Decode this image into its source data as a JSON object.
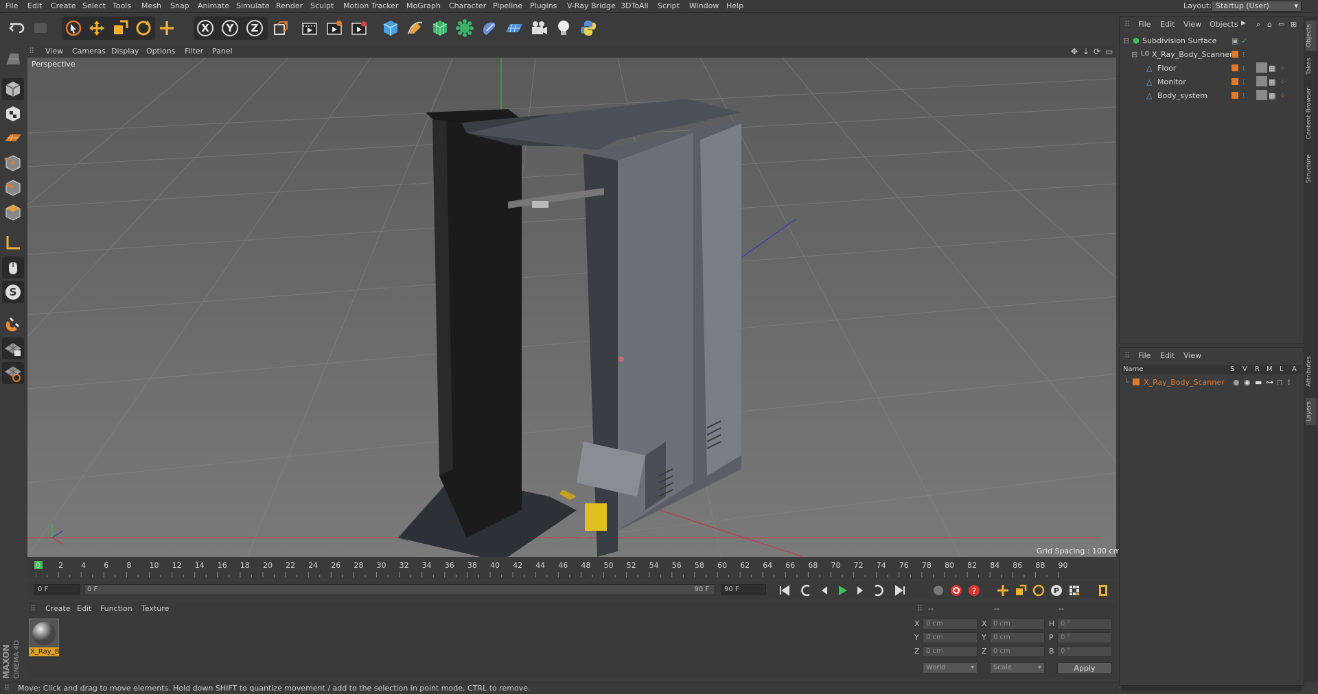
{
  "menubar": {
    "items": [
      "File",
      "Edit",
      "Create",
      "Select",
      "Tools",
      "Mesh",
      "Snap",
      "Animate",
      "Simulate",
      "Render",
      "Sculpt",
      "Motion Tracker",
      "MoGraph",
      "Character",
      "Pipeline",
      "Plugins",
      "V-Ray Bridge",
      "3DToAll",
      "Script",
      "Window",
      "Help"
    ],
    "layout_label": "Layout:",
    "layout_value": "Startup (User)"
  },
  "toolbar": {
    "icons": [
      "undo-icon",
      "redo-icon",
      "live-selection-icon",
      "move-icon",
      "scale-icon",
      "rotate-icon",
      "last-tool-icon",
      "x-axis-icon",
      "y-axis-icon",
      "z-axis-icon",
      "world-coordinates-icon",
      "render-view-icon",
      "render-picture-viewer-icon",
      "edit-render-settings-icon",
      "cube-icon",
      "pen-icon",
      "subdivision-icon",
      "array-icon",
      "deformer-icon",
      "floor-icon",
      "camera-icon",
      "light-icon",
      "python-icon"
    ],
    "axis_labels": [
      "X",
      "Y",
      "Z"
    ]
  },
  "viewport": {
    "menu": [
      "View",
      "Cameras",
      "Display",
      "Options",
      "Filter",
      "Panel"
    ],
    "label": "Perspective",
    "grid_spacing": "Grid Spacing : 100 cm"
  },
  "timeline": {
    "ticks": [
      "0",
      "2",
      "4",
      "6",
      "8",
      "10",
      "12",
      "14",
      "16",
      "18",
      "20",
      "22",
      "24",
      "26",
      "28",
      "30",
      "32",
      "34",
      "36",
      "38",
      "40",
      "42",
      "44",
      "46",
      "48",
      "50",
      "52",
      "54",
      "56",
      "58",
      "60",
      "62",
      "64",
      "66",
      "68",
      "70",
      "72",
      "74",
      "76",
      "78",
      "80",
      "82",
      "84",
      "86",
      "88",
      "90"
    ],
    "current_frame": "0 F",
    "end_frame": "0 F"
  },
  "playbar": {
    "start": "0 F",
    "range_start": "0 F",
    "range_end": "90 F",
    "end": "90 F"
  },
  "material_manager": {
    "menu": [
      "Create",
      "Edit",
      "Function",
      "Texture"
    ],
    "material_name": "X_Ray_B"
  },
  "coordinates": {
    "headers": [
      "--",
      "--",
      "--"
    ],
    "rows": [
      {
        "a": "X",
        "av": "0 cm",
        "b": "X",
        "bv": "0 cm",
        "c": "H",
        "cv": "0 °"
      },
      {
        "a": "Y",
        "av": "0 cm",
        "b": "Y",
        "bv": "0 cm",
        "c": "P",
        "cv": "0 °"
      },
      {
        "a": "Z",
        "av": "0 cm",
        "b": "Z",
        "bv": "0 cm",
        "c": "B",
        "cv": "0 °"
      }
    ],
    "mode": "World",
    "mode2": "Scale",
    "apply": "Apply"
  },
  "status": "Move: Click and drag to move elements. Hold down SHIFT to quantize movement / add to the selection in point mode, CTRL to remove.",
  "object_manager": {
    "menu": [
      "File",
      "Edit",
      "View",
      "Objects"
    ],
    "objects": [
      {
        "name": "Subdivision Surface",
        "indent": 0
      },
      {
        "name": "X_Ray_Body_Scanner",
        "indent": 1
      },
      {
        "name": "Floor",
        "indent": 2
      },
      {
        "name": "Monitor",
        "indent": 2
      },
      {
        "name": "Body_system",
        "indent": 2
      }
    ]
  },
  "layer_manager": {
    "menu": [
      "File",
      "Edit",
      "View"
    ],
    "headers": [
      "Name",
      "S",
      "V",
      "R",
      "M",
      "L",
      "A"
    ],
    "layers": [
      {
        "name": "X_Ray_Body_Scanner",
        "color": "#e07a2e"
      }
    ]
  },
  "side_tabs": [
    "Objects",
    "Takes",
    "Content Browser",
    "Structure",
    "Attributes",
    "Layers"
  ],
  "logo": {
    "brand": "MAXON",
    "product": "CINEMA 4D"
  },
  "colors": {
    "accent_orange": "#e07a2e",
    "selection_blue": "#6fa3d8",
    "playhead_green": "#3fbf5a"
  }
}
